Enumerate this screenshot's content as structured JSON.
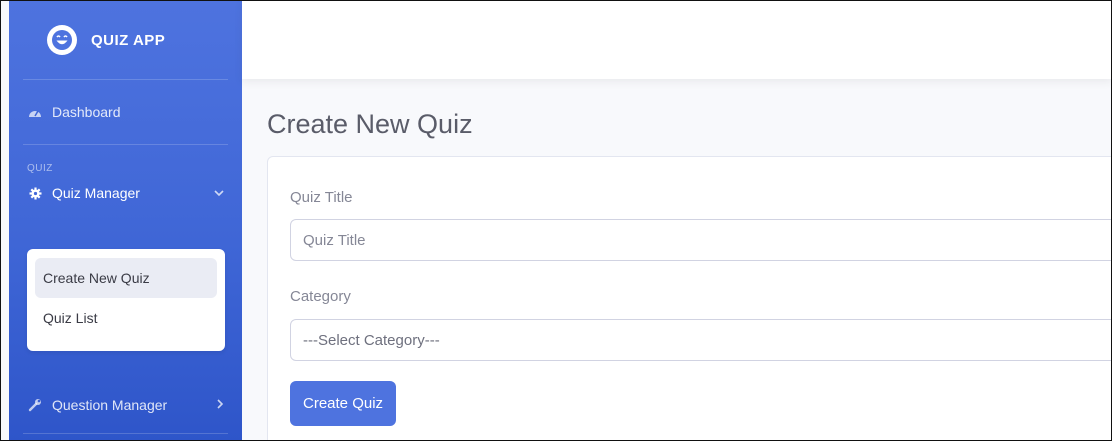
{
  "brand": {
    "name": "QUIZ APP",
    "icon": "laughing-face-icon"
  },
  "sidebar": {
    "dashboard": {
      "label": "Dashboard",
      "icon": "tachometer-icon"
    },
    "section_heading": "QUIZ",
    "quiz_manager": {
      "label": "Quiz Manager",
      "icon": "cog-icon",
      "chevron": "chevron-down-icon"
    },
    "quiz_submenu": [
      {
        "label": "Create New Quiz",
        "active": true
      },
      {
        "label": "Quiz List",
        "active": false
      }
    ],
    "question_manager": {
      "label": "Question Manager",
      "icon": "wrench-icon",
      "chevron": "chevron-right-icon"
    }
  },
  "main": {
    "title": "Create New Quiz",
    "form": {
      "quiz_title_label": "Quiz Title",
      "quiz_title_placeholder": "Quiz Title",
      "quiz_title_value": "",
      "category_label": "Category",
      "category_selected": "---Select Category---",
      "submit_label": "Create Quiz"
    }
  },
  "colors": {
    "primary": "#4e73df",
    "text_muted": "#858796",
    "heading": "#5a5c69"
  }
}
